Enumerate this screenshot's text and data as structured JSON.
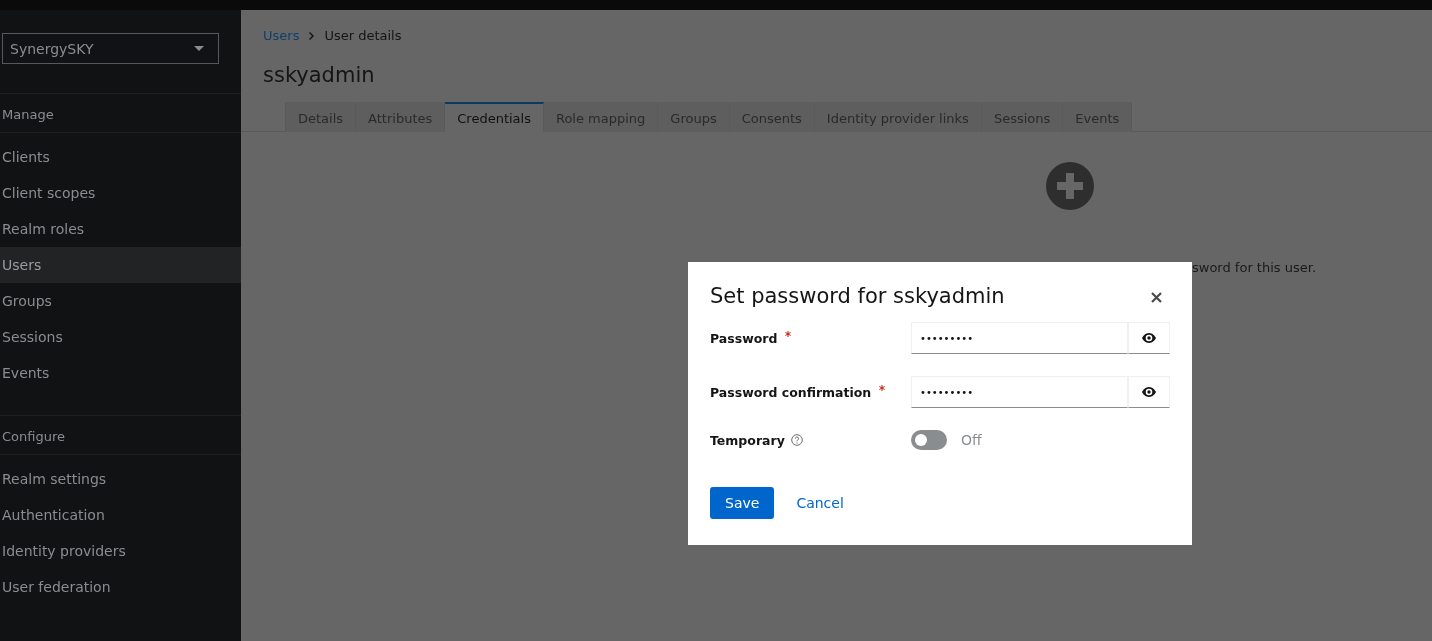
{
  "sidebar": {
    "realm_selector": {
      "value": "SynergySKY"
    },
    "sections": [
      {
        "title": "Manage",
        "items": [
          {
            "label": "Clients",
            "selected": false
          },
          {
            "label": "Client scopes",
            "selected": false
          },
          {
            "label": "Realm roles",
            "selected": false
          },
          {
            "label": "Users",
            "selected": true
          },
          {
            "label": "Groups",
            "selected": false
          },
          {
            "label": "Sessions",
            "selected": false
          },
          {
            "label": "Events",
            "selected": false
          }
        ]
      },
      {
        "title": "Configure",
        "items": [
          {
            "label": "Realm settings",
            "selected": false
          },
          {
            "label": "Authentication",
            "selected": false
          },
          {
            "label": "Identity providers",
            "selected": false
          },
          {
            "label": "User federation",
            "selected": false
          }
        ]
      }
    ]
  },
  "breadcrumb": [
    {
      "label": "Users",
      "kind": "link"
    },
    {
      "label": "User details",
      "kind": "current"
    }
  ],
  "page_title": "sskyadmin",
  "tabs": [
    {
      "label": "Details",
      "selected": false
    },
    {
      "label": "Attributes",
      "selected": false
    },
    {
      "label": "Credentials",
      "selected": true
    },
    {
      "label": "Role mapping",
      "selected": false
    },
    {
      "label": "Groups",
      "selected": false
    },
    {
      "label": "Consents",
      "selected": false
    },
    {
      "label": "Identity provider links",
      "selected": false
    },
    {
      "label": "Sessions",
      "selected": false
    },
    {
      "label": "Events",
      "selected": false
    }
  ],
  "empty_state": {
    "description": "sword for this user."
  },
  "modal": {
    "title": "Set password for sskyadmin",
    "fields": [
      {
        "label": "Password",
        "required": true,
        "value": "•••••••••"
      },
      {
        "label": "Password confirmation",
        "required": true,
        "value": "•••••••••"
      }
    ],
    "temporary": {
      "label": "Temporary",
      "on": false,
      "state_text": "Off"
    },
    "buttons": [
      {
        "label": "Save",
        "kind": "primary"
      },
      {
        "label": "Cancel",
        "kind": "link"
      }
    ]
  }
}
